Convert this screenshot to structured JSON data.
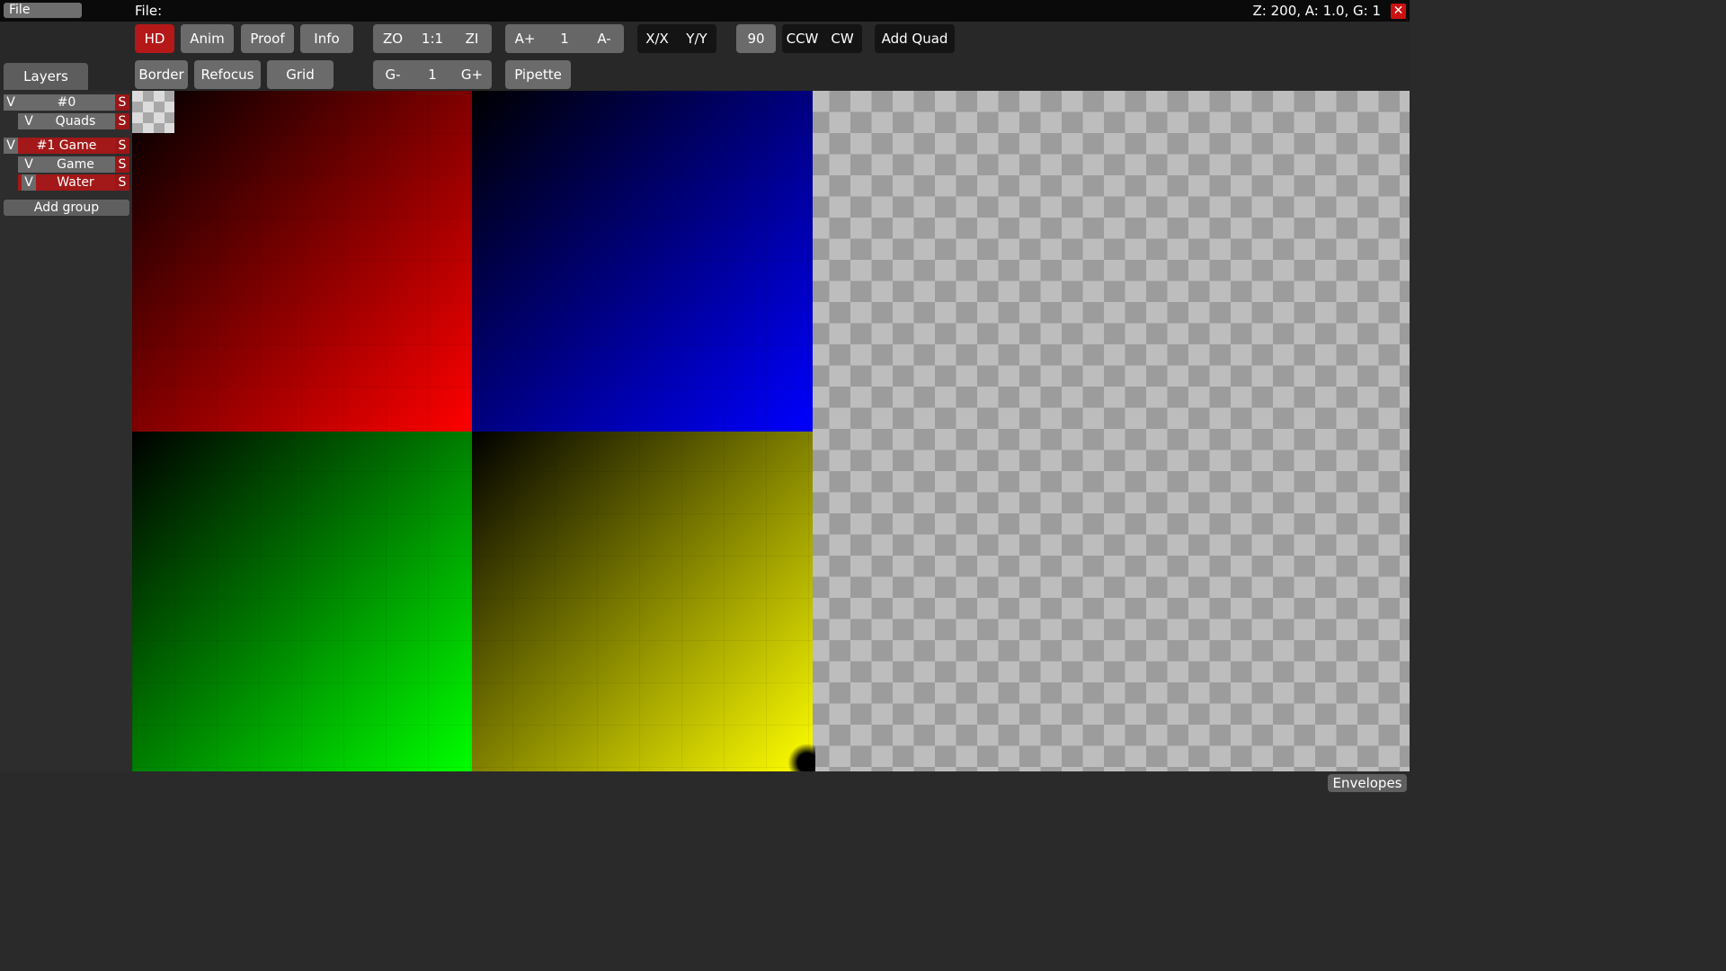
{
  "menu": {
    "file": "File"
  },
  "header": {
    "file_label": "File:",
    "status": "Z: 200, A: 1.0, G: 1",
    "close": "✕"
  },
  "toolbar": {
    "hd": "HD",
    "anim": "Anim",
    "proof": "Proof",
    "info": "Info",
    "zoom_out": "ZO",
    "zoom_reset": "1:1",
    "zoom_in": "ZI",
    "anim_faster": "A+",
    "anim_speed": "1",
    "anim_slower": "A-",
    "flip_x": "X/X",
    "flip_y": "Y/Y",
    "rotate_angle": "90",
    "ccw": "CCW",
    "cw": "CW",
    "add_quad": "Add Quad",
    "border": "Border",
    "refocus": "Refocus",
    "grid": "Grid",
    "grid_dec": "G-",
    "grid_factor": "1",
    "grid_inc": "G+",
    "pipette": "Pipette"
  },
  "sidebar": {
    "tab": "Layers",
    "groups": [
      {
        "vis": "V",
        "name": "#0",
        "solo": "S",
        "layers": [
          {
            "vis": "V",
            "name": "Quads",
            "solo": "S"
          }
        ]
      },
      {
        "vis": "V",
        "name": "#1 Game",
        "solo": "S",
        "layers": [
          {
            "vis": "V",
            "name": "Game",
            "solo": "S"
          },
          {
            "vis": "V",
            "name": "Water",
            "solo": "S"
          }
        ]
      }
    ],
    "add_group": "Add group"
  },
  "footer": {
    "envelopes": "Envelopes"
  },
  "colors": {
    "active": "#b51818",
    "button": "#6b6b6b",
    "dark_button": "#141414",
    "red": "#ff0000",
    "blue": "#0000ff",
    "green": "#00ff00",
    "yellow": "#ffff00"
  }
}
